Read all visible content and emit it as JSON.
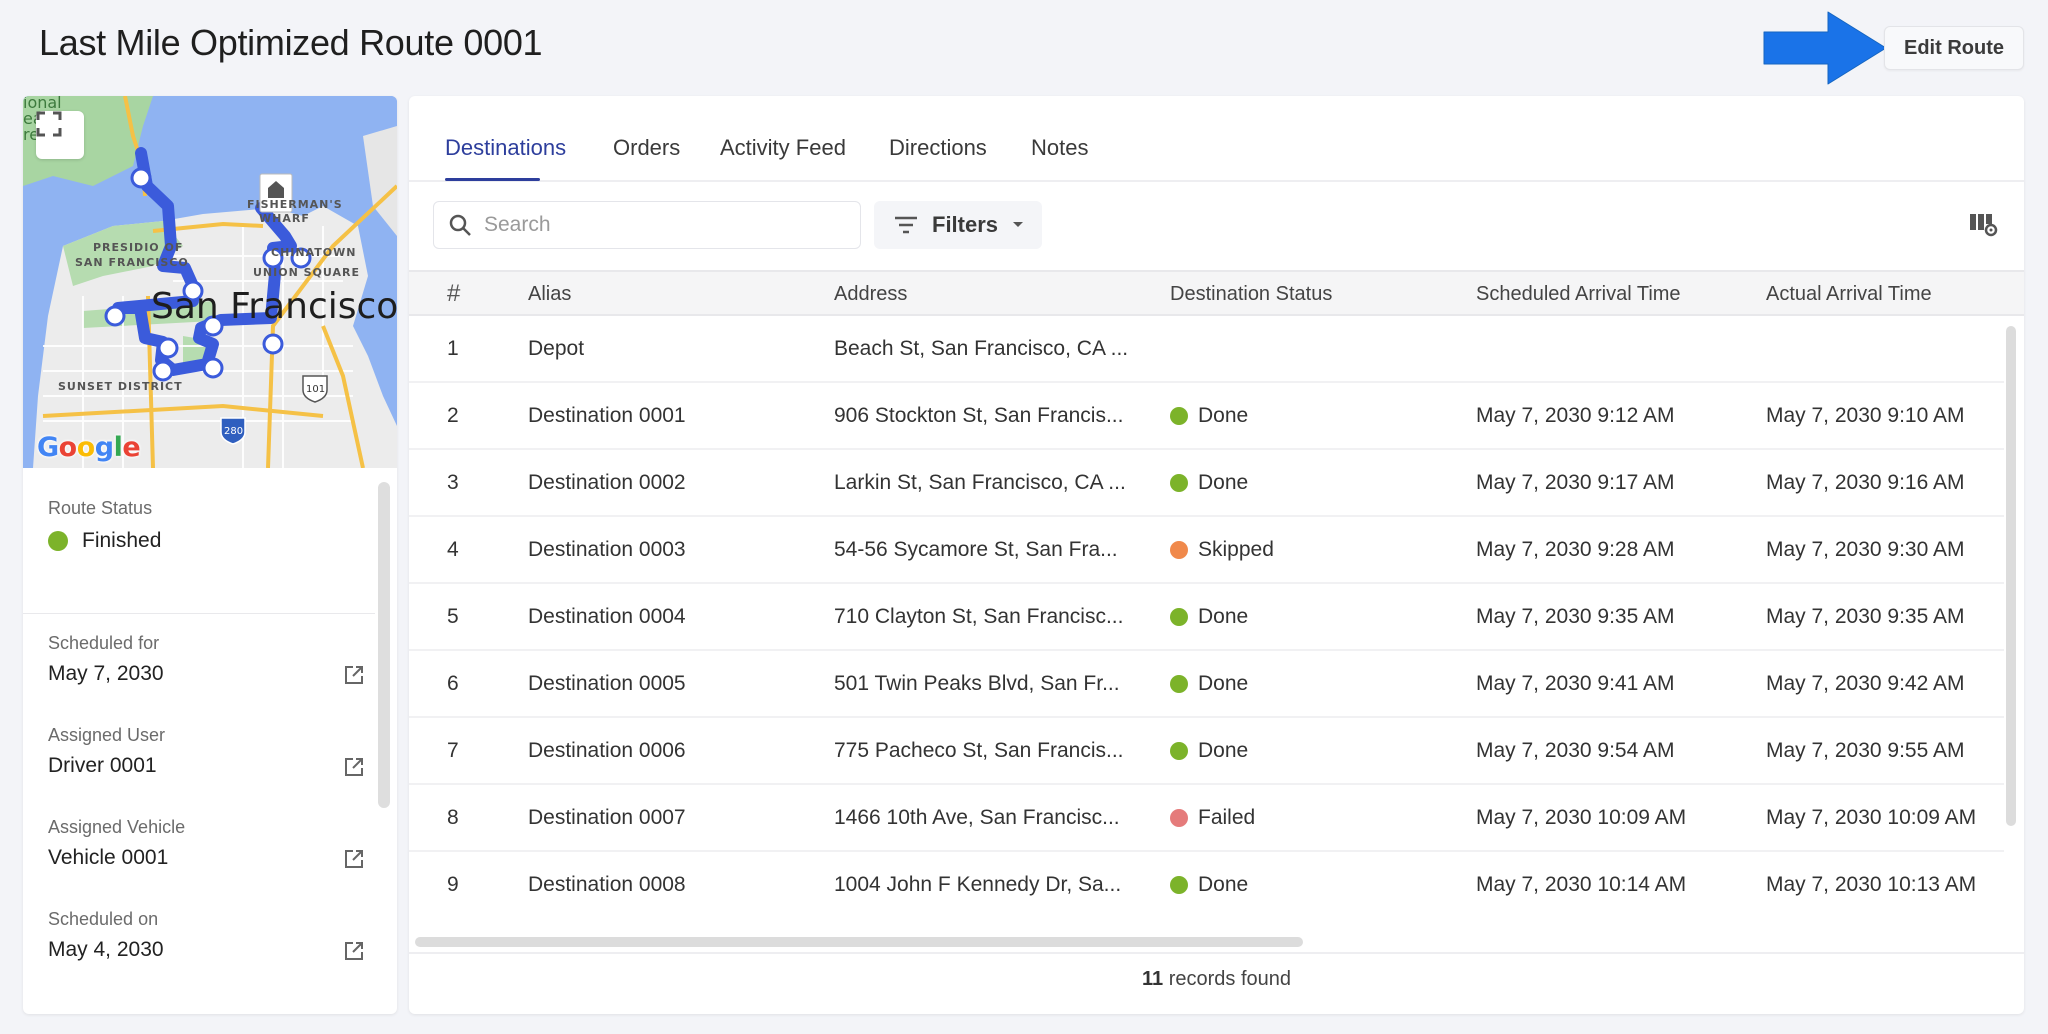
{
  "header": {
    "title": "Last Mile Optimized Route 0001",
    "edit_button": "Edit Route",
    "arrow_color": "#1a73e8"
  },
  "map": {
    "labels": [
      "San Francisco",
      "PRESIDIO OF",
      "SAN FRANCISCO",
      "FISHERMAN'S",
      "WHARF",
      "CHINATOWN",
      "UNION SQUARE",
      "SUNSET DISTRICT",
      "101",
      "280",
      "ional",
      "ea",
      "re"
    ],
    "attribution": "Google",
    "route_color": "#3b5bdb"
  },
  "route_info": {
    "status_label": "Route Status",
    "status_value": "Finished",
    "status_color": "#7cb32a",
    "fields": [
      {
        "label": "Scheduled for",
        "value": "May 7, 2030"
      },
      {
        "label": "Assigned User",
        "value": "Driver 0001"
      },
      {
        "label": "Assigned Vehicle",
        "value": "Vehicle 0001"
      },
      {
        "label": "Scheduled on",
        "value": "May 4, 2030"
      }
    ]
  },
  "tabs": [
    {
      "label": "Destinations",
      "active": true
    },
    {
      "label": "Orders",
      "active": false
    },
    {
      "label": "Activity Feed",
      "active": false
    },
    {
      "label": "Directions",
      "active": false
    },
    {
      "label": "Notes",
      "active": false
    }
  ],
  "toolbar": {
    "search_placeholder": "Search",
    "search_value": "",
    "filters_label": "Filters"
  },
  "table": {
    "columns": [
      "#",
      "Alias",
      "Address",
      "Destination Status",
      "Scheduled Arrival Time",
      "Actual Arrival Time"
    ],
    "status_colors": {
      "Done": "#7cb32a",
      "Skipped": "#f0894b",
      "Failed": "#e57b7b"
    },
    "rows": [
      {
        "num": "1",
        "alias": "Depot",
        "address": "Beach St, San Francisco, CA ...",
        "status": "",
        "scheduled": "",
        "actual": ""
      },
      {
        "num": "2",
        "alias": "Destination 0001",
        "address": "906 Stockton St, San Francis...",
        "status": "Done",
        "scheduled": "May 7, 2030 9:12 AM",
        "actual": "May 7, 2030 9:10 AM"
      },
      {
        "num": "3",
        "alias": "Destination 0002",
        "address": "Larkin St, San Francisco, CA ...",
        "status": "Done",
        "scheduled": "May 7, 2030 9:17 AM",
        "actual": "May 7, 2030 9:16 AM"
      },
      {
        "num": "4",
        "alias": "Destination 0003",
        "address": "54-56 Sycamore St, San Fra...",
        "status": "Skipped",
        "scheduled": "May 7, 2030 9:28 AM",
        "actual": "May 7, 2030 9:30 AM"
      },
      {
        "num": "5",
        "alias": "Destination 0004",
        "address": "710 Clayton St, San Francisc...",
        "status": "Done",
        "scheduled": "May 7, 2030 9:35 AM",
        "actual": "May 7, 2030 9:35 AM"
      },
      {
        "num": "6",
        "alias": "Destination 0005",
        "address": "501 Twin Peaks Blvd, San Fr...",
        "status": "Done",
        "scheduled": "May 7, 2030 9:41 AM",
        "actual": "May 7, 2030 9:42 AM"
      },
      {
        "num": "7",
        "alias": "Destination 0006",
        "address": "775 Pacheco St, San Francis...",
        "status": "Done",
        "scheduled": "May 7, 2030 9:54 AM",
        "actual": "May 7, 2030 9:55 AM"
      },
      {
        "num": "8",
        "alias": "Destination 0007",
        "address": "1466 10th Ave, San Francisc...",
        "status": "Failed",
        "scheduled": "May 7, 2030 10:09 AM",
        "actual": "May 7, 2030 10:09 AM"
      },
      {
        "num": "9",
        "alias": "Destination 0008",
        "address": "1004 John F Kennedy Dr, Sa...",
        "status": "Done",
        "scheduled": "May 7, 2030 10:14 AM",
        "actual": "May 7, 2030 10:13 AM"
      }
    ]
  },
  "footer": {
    "count": "11",
    "count_suffix": " records found"
  }
}
